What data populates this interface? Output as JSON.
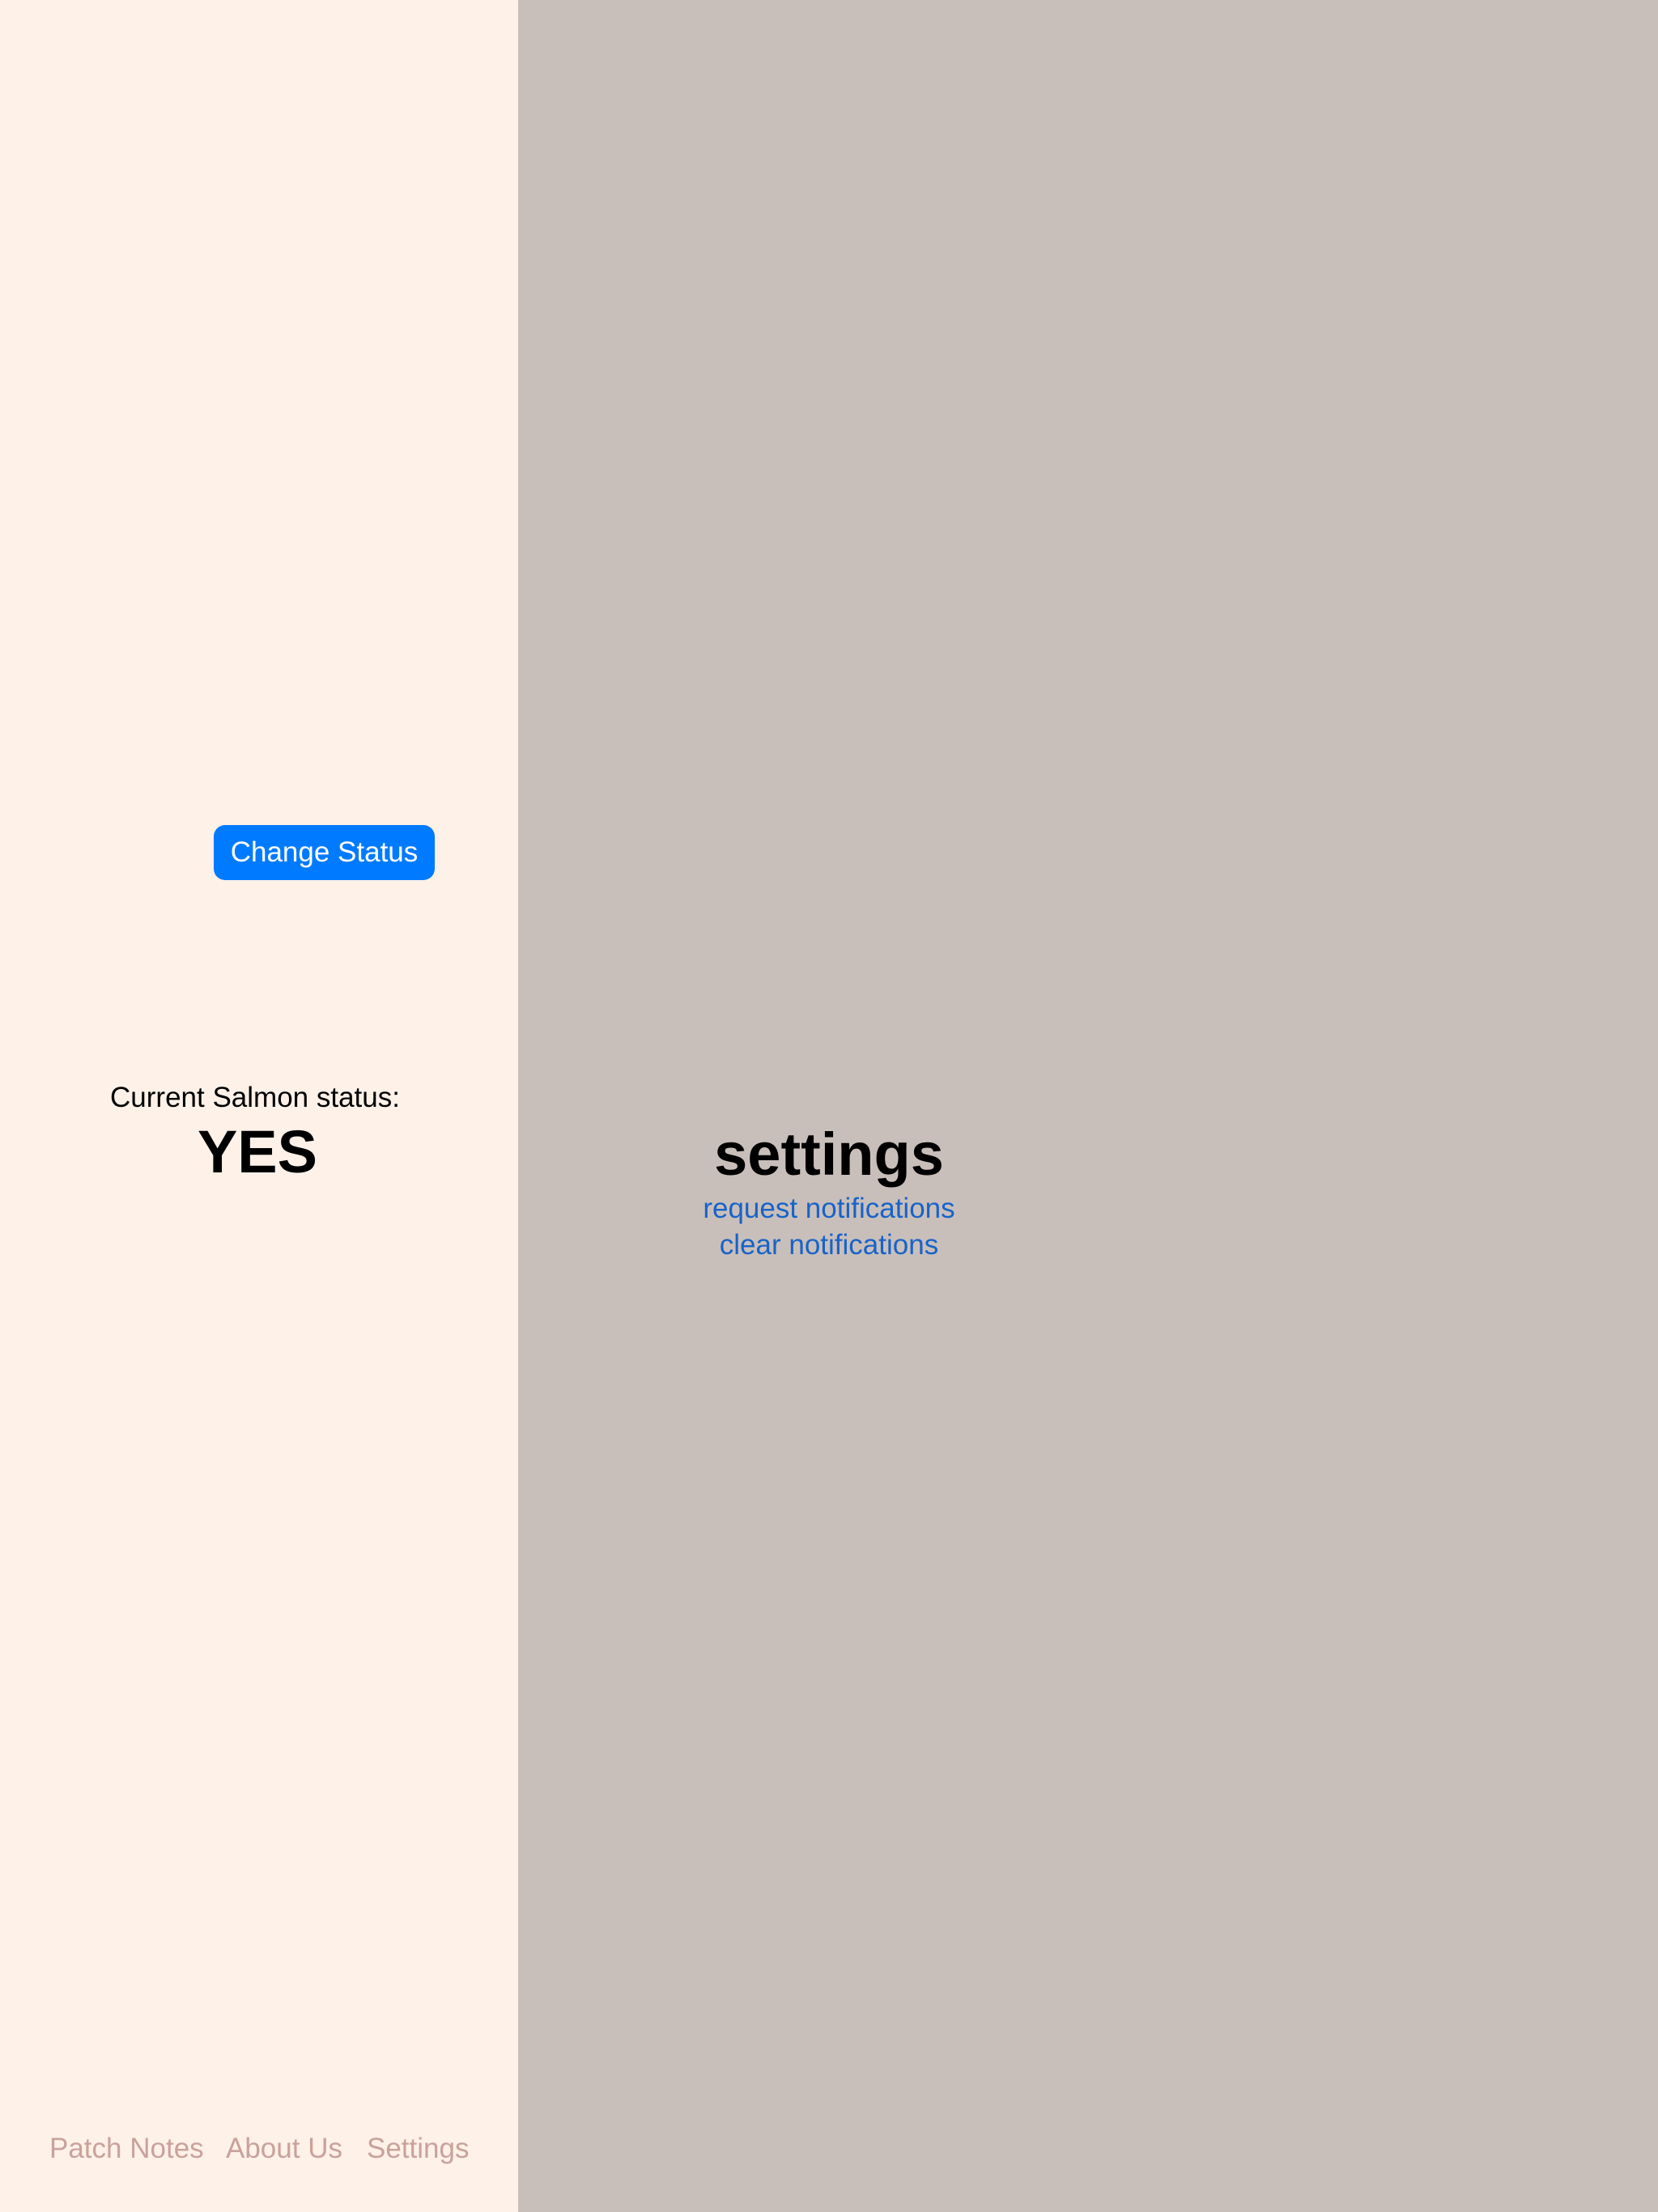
{
  "colors": {
    "sidebar_background": "#fdf1e8",
    "detail_background": "#c9bfba",
    "accent": "#007aff",
    "link": "#1763c9",
    "tab_inactive": "#c9a29a"
  },
  "status_panel": {
    "button_label": "Change Status",
    "label": "Current Salmon status:",
    "value": "YES"
  },
  "tabs": [
    {
      "label": "Patch Notes"
    },
    {
      "label": "About Us"
    },
    {
      "label": "Settings"
    }
  ],
  "settings": {
    "title": "settings",
    "links": [
      {
        "label": "request notifications"
      },
      {
        "label": "clear notifications"
      }
    ]
  }
}
